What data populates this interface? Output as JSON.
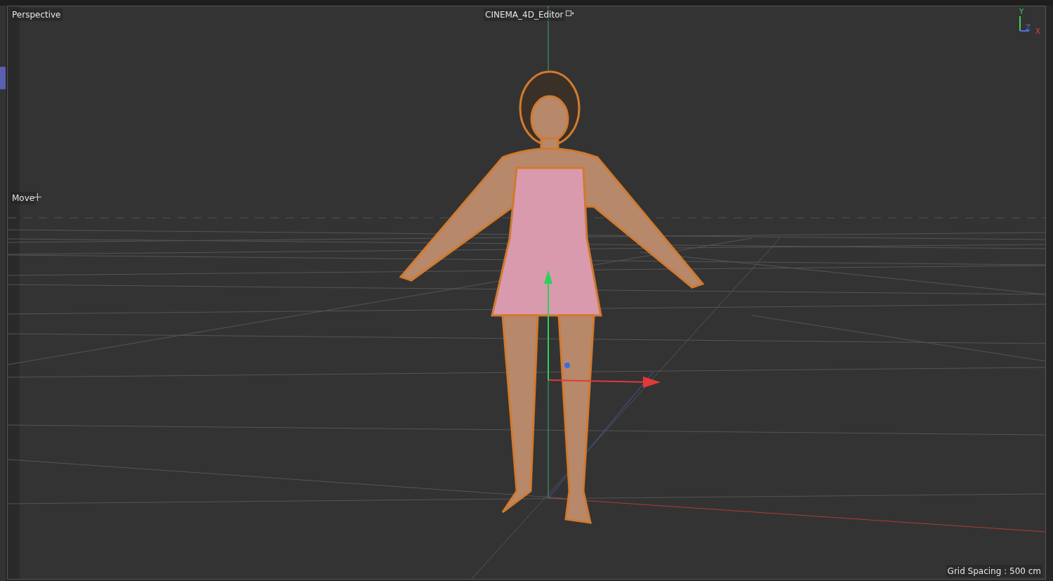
{
  "viewport": {
    "view_name": "Perspective",
    "camera": "CINEMA_4D_Editor",
    "active_tool": "Move",
    "axis_labels": [
      "Y",
      "Z",
      "X"
    ],
    "grid_spacing": "Grid Spacing : 500 cm"
  }
}
